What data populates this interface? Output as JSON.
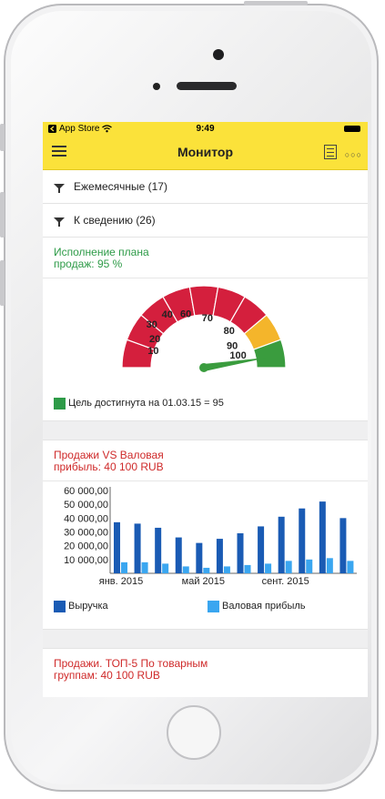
{
  "status_bar": {
    "back_app": "App Store",
    "time": "9:49"
  },
  "navbar": {
    "title": "Монитор"
  },
  "filters": [
    {
      "label": "Ежемесячные (17)"
    },
    {
      "label": "К сведению (26)"
    }
  ],
  "gauge_card": {
    "title": "Исполнение плана продаж: 95 %",
    "legend": "Цель достигнута на 01.03.15 = 95",
    "value": 95,
    "colors": {
      "red": "#d41f3d",
      "orange": "#f4b52b",
      "green": "#3a9c3e",
      "needle": "#3a9c3e"
    },
    "tick_labels": [
      "10",
      "20",
      "30",
      "40",
      "60",
      "70",
      "80",
      "90",
      "100"
    ]
  },
  "sales_card": {
    "title": "Продажи VS Валовая прибыль: 40 100 RUB",
    "legend": [
      {
        "label": "Выручка",
        "color": "#1a5bb4"
      },
      {
        "label": "Валовая прибыль",
        "color": "#3aa6f0"
      }
    ]
  },
  "top5_card": {
    "title": "Продажи. ТОП-5 По товарным группам: 40 100 RUB"
  },
  "chart_data": {
    "type": "bar",
    "categories": [
      "янв. 2015",
      "",
      "",
      "",
      "май 2015",
      "",
      "",
      "",
      "сент. 2015",
      "",
      "",
      ""
    ],
    "x_tick_labels": [
      "янв. 2015",
      "май 2015",
      "сент. 2015"
    ],
    "y_tick_labels": [
      "60 000,00",
      "50 000,00",
      "40 000,00",
      "30 000,00",
      "20 000,00",
      "10 000,00"
    ],
    "ylim": [
      0,
      60000
    ],
    "series": [
      {
        "name": "Выручка",
        "color": "#1a5bb4",
        "values": [
          37000,
          36000,
          33000,
          26000,
          22000,
          25000,
          29000,
          34000,
          41000,
          47000,
          52000,
          40000
        ]
      },
      {
        "name": "Валовая прибыль",
        "color": "#3aa6f0",
        "values": [
          8000,
          8000,
          7000,
          5000,
          4000,
          5000,
          6000,
          7000,
          9000,
          10000,
          11000,
          9000
        ]
      }
    ]
  }
}
